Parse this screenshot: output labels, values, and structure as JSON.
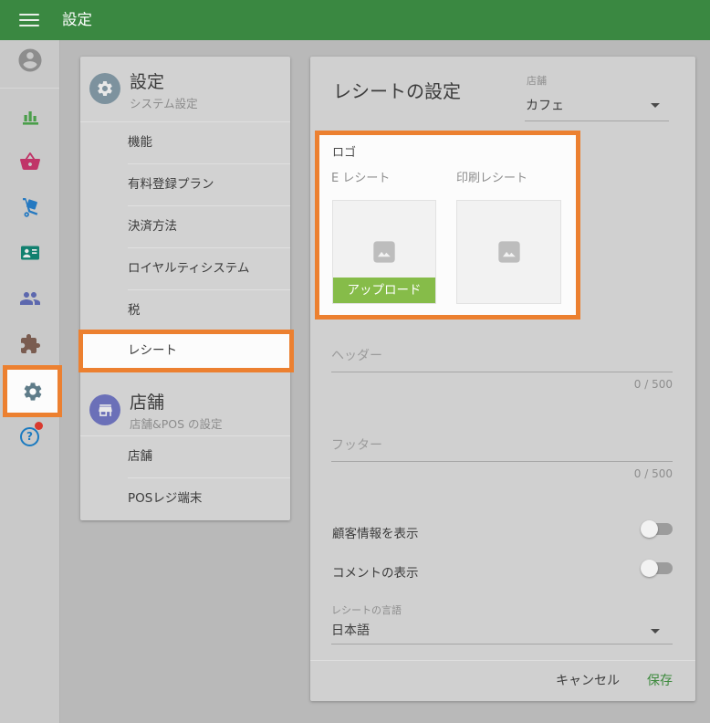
{
  "colors": {
    "topbar_green": "#3a8841",
    "accent_orange": "#ec8030",
    "upload_green": "#86bc49",
    "save_green": "#3d8a3d"
  },
  "topbar": {
    "title": "設定"
  },
  "sidebar": {
    "help_glyph": "?",
    "icons": [
      {
        "name": "account-icon"
      },
      {
        "name": "reports-icon"
      },
      {
        "name": "items-basket-icon"
      },
      {
        "name": "inventory-trolley-icon"
      },
      {
        "name": "customers-badge-icon"
      },
      {
        "name": "employees-icon"
      },
      {
        "name": "apps-puzzle-icon"
      },
      {
        "name": "settings-gear-icon",
        "highlighted": true
      },
      {
        "name": "help-icon",
        "has_notification": true
      }
    ]
  },
  "menu": {
    "sections": [
      {
        "title": "設定",
        "subtitle": "システム設定",
        "icon": "gear-icon",
        "items": [
          "機能",
          "有料登録プラン",
          "決済方法",
          "ロイヤルティシステム",
          "税",
          "レシート"
        ],
        "active_item": "レシート"
      },
      {
        "title": "店舗",
        "subtitle": "店舗&POS の設定",
        "icon": "store-icon",
        "items": [
          "店舗",
          "POSレジ端末"
        ]
      }
    ]
  },
  "content": {
    "title": "レシートの設定",
    "store_select": {
      "label": "店舗",
      "value": "カフェ"
    },
    "logo": {
      "label": "ロゴ",
      "columns": [
        "E レシート",
        "印刷レシート"
      ],
      "upload_button": "アップロード"
    },
    "fields": [
      {
        "label": "ヘッダー",
        "counter": "0 / 500"
      },
      {
        "label": "フッター",
        "counter": "0 / 500"
      }
    ],
    "toggles": [
      {
        "label": "顧客情報を表示",
        "on": false
      },
      {
        "label": "コメントの表示",
        "on": false
      }
    ],
    "language_select": {
      "label": "レシートの言語",
      "value": "日本語"
    },
    "actions": {
      "cancel": "キャンセル",
      "save": "保存"
    }
  }
}
